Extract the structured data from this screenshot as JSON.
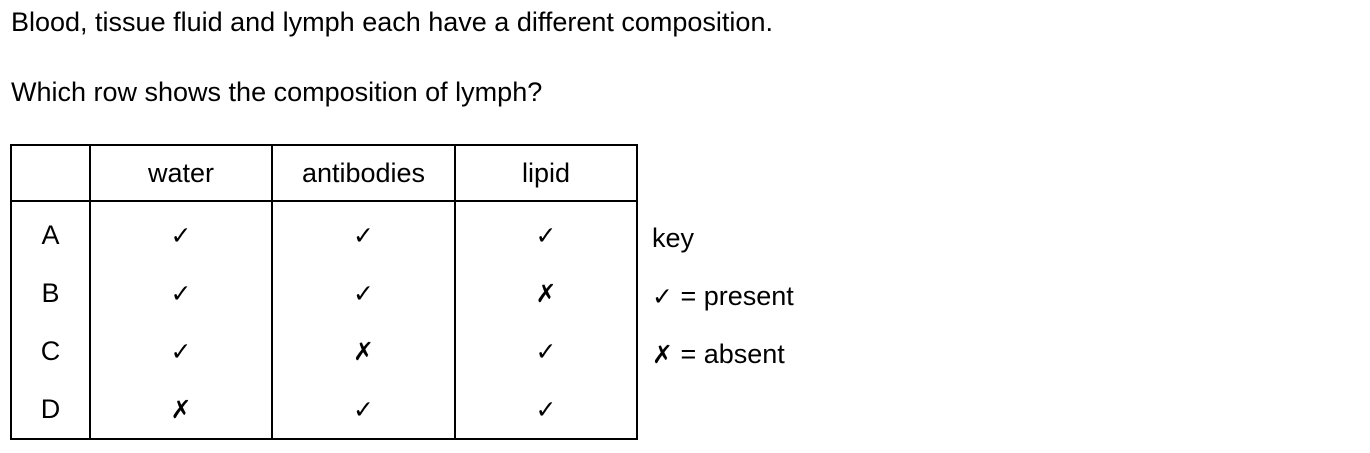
{
  "intro": "Blood, tissue fluid and lymph each have a different composition.",
  "question": "Which row shows the composition of lymph?",
  "table": {
    "headers": [
      "",
      "water",
      "antibodies",
      "lipid"
    ],
    "rows": [
      {
        "letter": "A",
        "water": "✓",
        "antibodies": "✓",
        "lipid": "✓"
      },
      {
        "letter": "B",
        "water": "✓",
        "antibodies": "✓",
        "lipid": "✗"
      },
      {
        "letter": "C",
        "water": "✓",
        "antibodies": "✗",
        "lipid": "✓"
      },
      {
        "letter": "D",
        "water": "✗",
        "antibodies": "✓",
        "lipid": "✓"
      }
    ]
  },
  "key": {
    "title": "key",
    "present_symbol": "✓",
    "present_text": " = present",
    "absent_symbol": "✗",
    "absent_text": " = absent"
  }
}
